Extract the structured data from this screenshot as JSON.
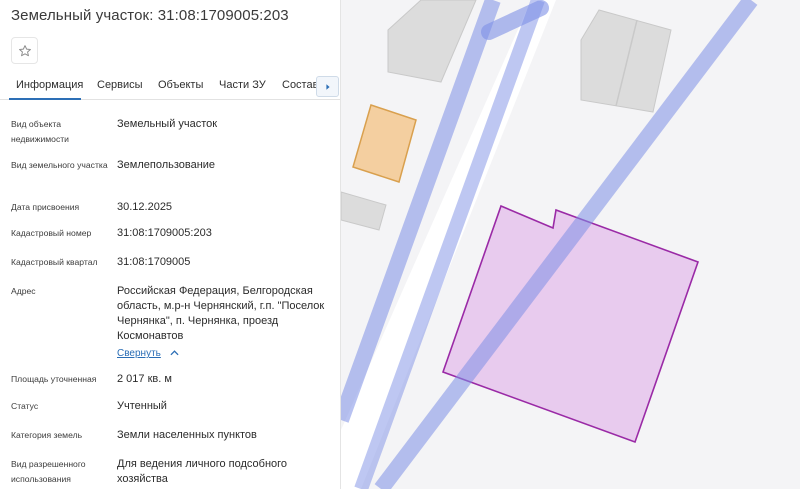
{
  "header": {
    "title": "Земельный участок: 31:08:1709005:203"
  },
  "tabs": [
    {
      "label": "Информация",
      "active": true
    },
    {
      "label": "Сервисы",
      "active": false
    },
    {
      "label": "Объекты",
      "active": false
    },
    {
      "label": "Части ЗУ",
      "active": false
    },
    {
      "label": "Состав",
      "active": false
    }
  ],
  "info": {
    "object_type_label": "Вид объекта недвижимости",
    "object_type_value": "Земельный участок",
    "land_type_label": "Вид земельного участка",
    "land_type_value": "Землепользование",
    "assign_date_label": "Дата присвоения",
    "assign_date_value": "30.12.2025",
    "cad_number_label": "Кадастровый номер",
    "cad_number_value": "31:08:1709005:203",
    "cad_quarter_label": "Кадастровый квартал",
    "cad_quarter_value": "31:08:1709005",
    "address_label": "Адрес",
    "address_value": "Российская Федерация, Белгородская область, м.р-н Чернянский, г.п. \"Поселок Чернянка\", п. Чернянка, проезд Космонавтов",
    "collapse_link": "Свернуть",
    "area_label": "Площадь уточненная",
    "area_value": "2 017 кв. м",
    "status_label": "Статус",
    "status_value": "Учтенный",
    "land_category_label": "Категория земель",
    "land_category_value": "Земли населенных пунктов",
    "permitted_use_label": "Вид разрешенного использования",
    "permitted_use_value": "Для ведения личного подсобного хозяйства"
  },
  "colors": {
    "accent": "#2d6fb6",
    "parcel_fill": "#e5c3ec",
    "parcel_stroke": "#9a2aa6",
    "road": "#8f9de8",
    "building": "#dcdcdc",
    "orange_building": "#f4cfa0"
  },
  "icons": {
    "favorite": "star-outline-icon",
    "tabs_next": "chevron-right-icon",
    "collapse": "chevron-up-icon"
  }
}
